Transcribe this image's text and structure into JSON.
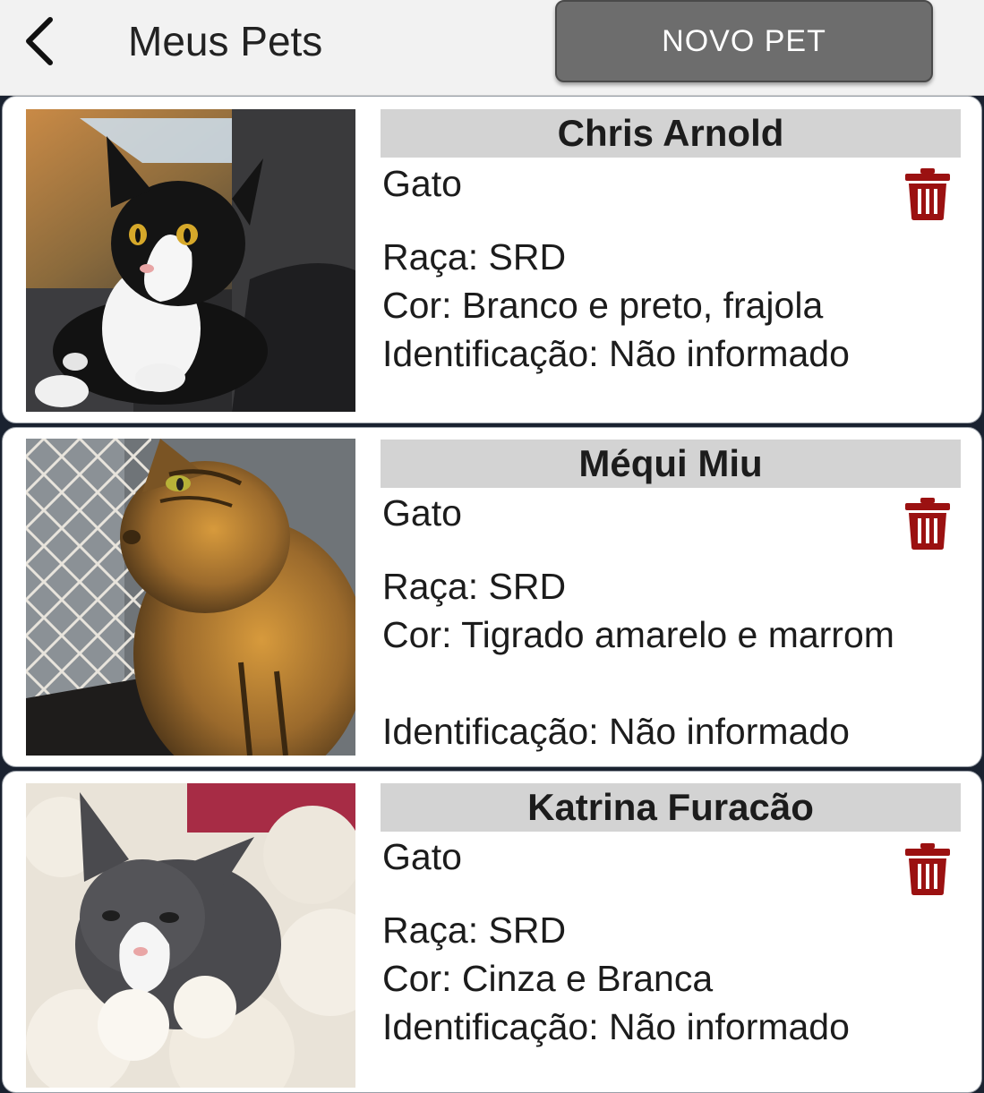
{
  "header": {
    "back_icon": "chevron-left-icon",
    "title": "Meus Pets",
    "new_pet_label": "NOVO PET"
  },
  "colors": {
    "header_bg": "#f2f2f2",
    "button_bg": "#6d6d6d",
    "name_bar_bg": "#d3d3d3",
    "trash_color": "#9b1111",
    "page_bg": "#1a2230"
  },
  "pets": [
    {
      "name": "Chris Arnold",
      "species": "Gato",
      "breed": "Raça: SRD",
      "color": "Cor: Branco e preto, frajola",
      "identification": "Identificação: Não informado",
      "photo": "black-and-white-cat-photo",
      "delete_icon": "trash-icon"
    },
    {
      "name": "Méqui Miu",
      "species": "Gato",
      "breed": "Raça: SRD",
      "color": "Cor: Tigrado amarelo e marrom",
      "identification": "Identificação: Não informado",
      "photo": "tabby-cat-photo",
      "delete_icon": "trash-icon"
    },
    {
      "name": "Katrina Furacão",
      "species": "Gato",
      "breed": "Raça: SRD",
      "color": "Cor: Cinza e Branca",
      "identification": "Identificação: Não informado",
      "photo": "gray-kitten-photo",
      "delete_icon": "trash-icon"
    }
  ]
}
